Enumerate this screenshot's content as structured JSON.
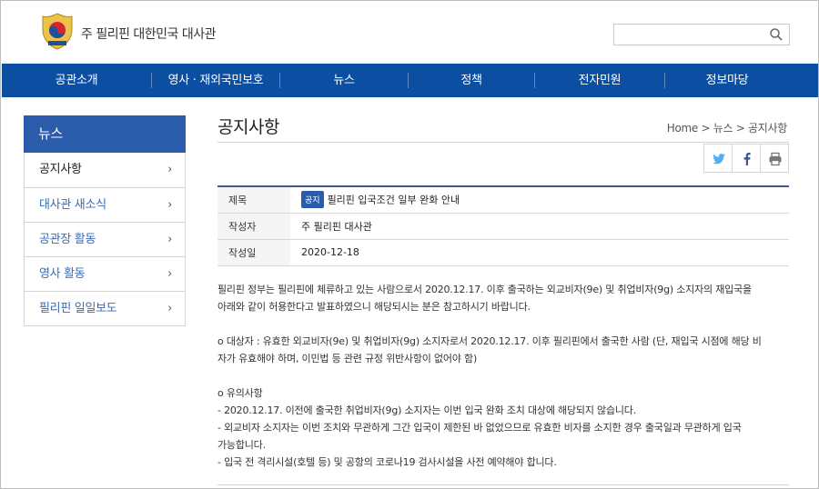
{
  "header": {
    "site_title": "주 필리핀 대한민국 대사관",
    "search_placeholder": ""
  },
  "nav": {
    "items": [
      "공관소개",
      "영사 · 재외국민보호",
      "뉴스",
      "정책",
      "전자민원",
      "정보마당"
    ]
  },
  "sidebar": {
    "title": "뉴스",
    "items": [
      {
        "label": "공지사항"
      },
      {
        "label": "대사관 새소식"
      },
      {
        "label": "공관장 활동"
      },
      {
        "label": "영사 활동"
      },
      {
        "label": "필리핀 일일보도"
      }
    ]
  },
  "content": {
    "page_title": "공지사항",
    "breadcrumb": "Home > 뉴스 > 공지사항",
    "table": {
      "subject_label": "제목",
      "badge": "공지",
      "subject": "필리핀 입국조건 일부 완화 안내",
      "author_label": "작성자",
      "author": "주 필리핀 대사관",
      "date_label": "작성일",
      "date": "2020-12-18"
    },
    "body": {
      "p1_line1": "필리핀 정부는 필리핀에 체류하고 있는 사람으로서 2020.12.17. 이후 출국하는 외교비자(9e) 및 취업비자(9g) 소지자의 재입국을",
      "p1_line2": "아래와 같이 허용한다고 발표하였으니 해당되시는 분은 참고하시기 바랍니다.",
      "p2_line1": "o 대상자 : 유효한 외교비자(9e) 및 취업비자(9g) 소지자로서 2020.12.17. 이후 필리핀에서 출국한 사람 (단, 재입국 시점에 해당 비",
      "p2_line2": "자가 유효해야 하며, 이민법 등 관련 규정 위반사항이 없어야 함)",
      "p3_heading": "o 유의사항",
      "p3_item1": "- 2020.12.17. 이전에 출국한 취업비자(9g) 소지자는 이번 입국 완화 조치 대상에 해당되지 않습니다.",
      "p3_item2_line1": "- 외교비자 소지자는 이번 조치와 무관하게 그간 입국이 제한된 바 없었으므로 유효한 비자를 소지한 경우 출국일과 무관하게 입국",
      "p3_item2_line2": "가능합니다.",
      "p3_item3": "- 입국 전 격리시설(호텔 등) 및 공항의 코로나19 검사시설을 사전 예약해야 합니다."
    }
  },
  "colors": {
    "nav_bg": "#0c4ea2",
    "sidebar_head_bg": "#2b5cab",
    "link_blue": "#3a6bb3",
    "table_top_border": "#3b5c8f",
    "twitter": "#55acee",
    "facebook": "#3b5998"
  }
}
